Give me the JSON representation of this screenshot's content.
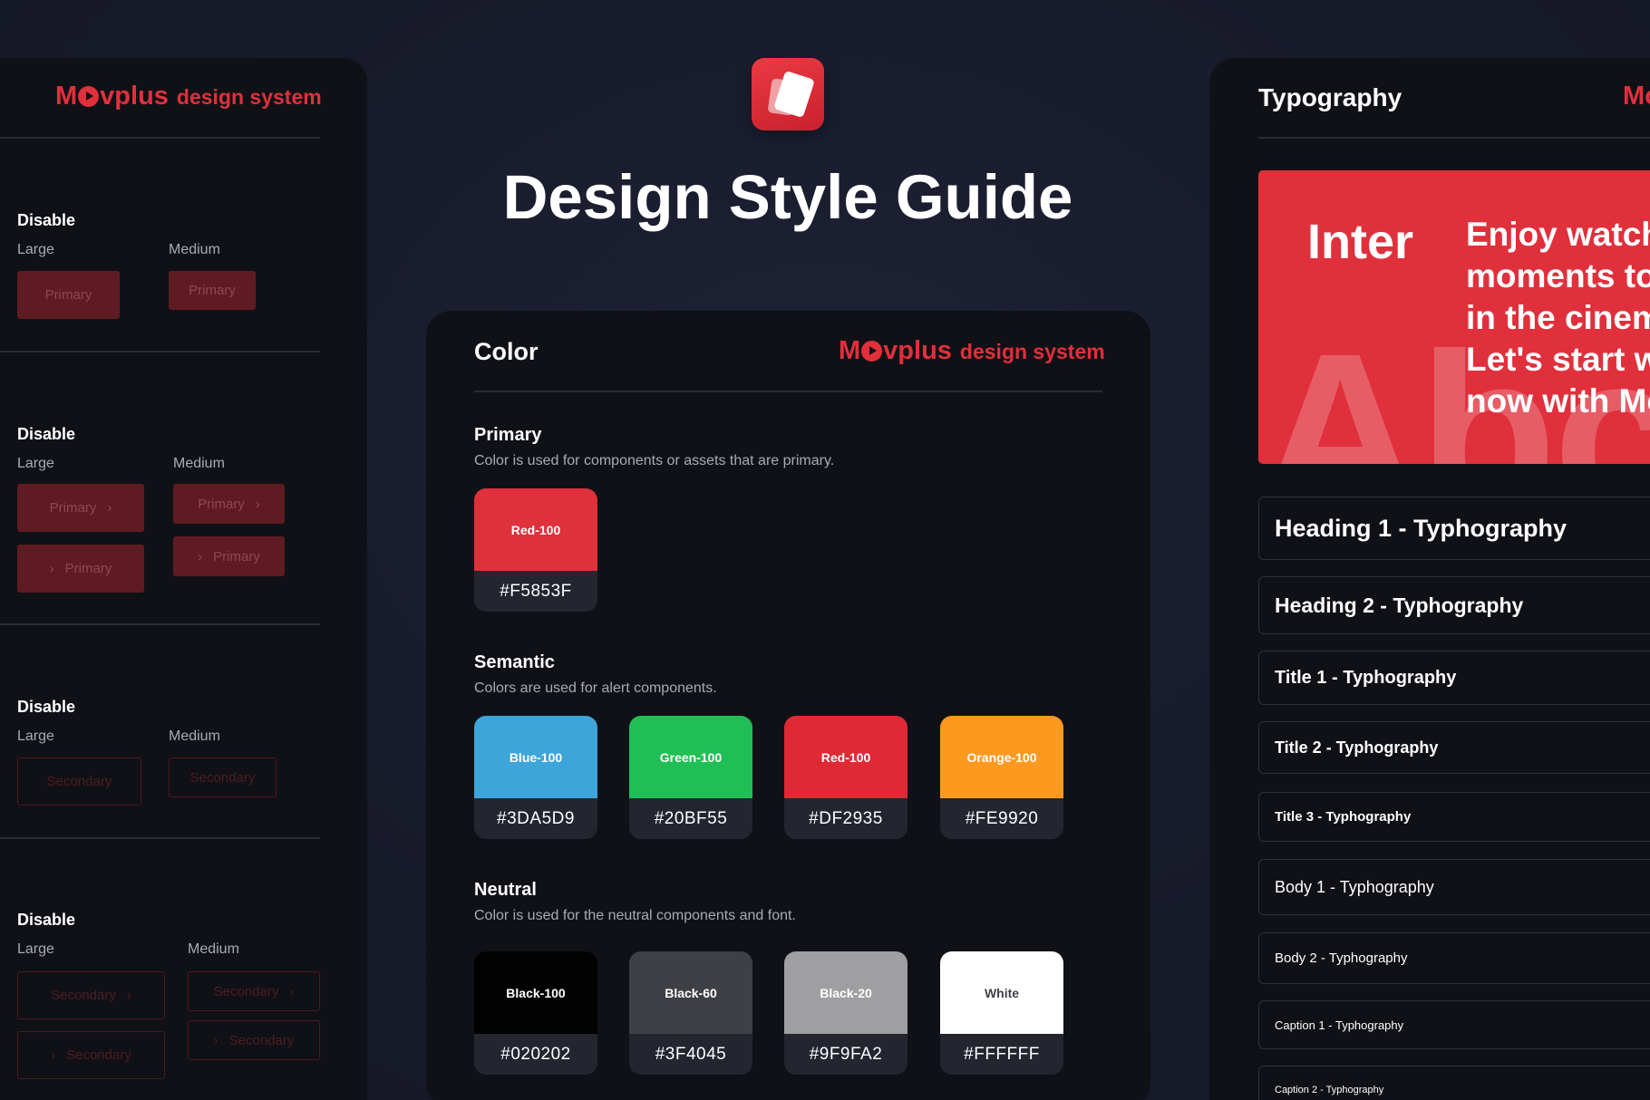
{
  "brand": {
    "name_start": "M",
    "name_end": "vplus",
    "tagline": "design system"
  },
  "header": {
    "title": "Design Style Guide"
  },
  "buttons_panel": {
    "groups": [
      {
        "title": "Disable",
        "large": "Large",
        "medium": "Medium",
        "buttons": {
          "large": "Primary",
          "medium": "Primary"
        }
      },
      {
        "title": "Disable",
        "large": "Large",
        "medium": "Medium",
        "buttons": {
          "large_trailing": "Primary",
          "large_leading": "Primary",
          "medium_trailing": "Primary",
          "medium_leading": "Primary"
        }
      },
      {
        "title": "Disable",
        "large": "Large",
        "medium": "Medium",
        "buttons": {
          "large": "Secondary",
          "medium": "Secondary"
        }
      },
      {
        "title": "Disable",
        "large": "Large",
        "medium": "Medium",
        "buttons": {
          "large_trailing": "Secondary",
          "large_leading": "Secondary",
          "medium_trailing": "Secondary",
          "medium_leading": "Secondary"
        }
      }
    ]
  },
  "color_panel": {
    "title": "Color",
    "primary": {
      "title": "Primary",
      "description": "Color is used for components or assets that are primary.",
      "swatches": [
        {
          "name": "Red-100",
          "hex": "#F5853F",
          "color": "#e0303c"
        }
      ]
    },
    "semantic": {
      "title": "Semantic",
      "description": "Colors are used for alert components.",
      "swatches": [
        {
          "name": "Blue-100",
          "hex": "#3DA5D9",
          "color": "#3da5d9"
        },
        {
          "name": "Green-100",
          "hex": "#20BF55",
          "color": "#20bf55"
        },
        {
          "name": "Red-100",
          "hex": "#DF2935",
          "color": "#df2935"
        },
        {
          "name": "Orange-100",
          "hex": "#FE9920",
          "color": "#fe9920"
        }
      ]
    },
    "neutral": {
      "title": "Neutral",
      "description": "Color is used for the neutral components and font.",
      "swatches": [
        {
          "name": "Black-100",
          "hex": "#020202",
          "color": "#020202"
        },
        {
          "name": "Black-60",
          "hex": "#3F4045",
          "color": "#3f4045"
        },
        {
          "name": "Black-20",
          "hex": "#9F9FA2",
          "color": "#9f9fa2"
        },
        {
          "name": "White",
          "hex": "#FFFFFF",
          "color": "#ffffff"
        }
      ]
    }
  },
  "typography_panel": {
    "title": "Typography",
    "brand_partial": "Mo",
    "hero": {
      "font_name": "Inter",
      "background_text": "Abc",
      "sample": "Enjoy watching\nmoments to\nin the cinema\nLet's start w\nnow with Mo"
    },
    "rows": [
      "Heading 1 - Typhography",
      "Heading 2 - Typhography",
      "Title 1 - Typhography",
      "Title 2 - Typhography",
      "Title 3 - Typhography",
      "Body 1 - Typhography",
      "Body 2 -  Typhography",
      "Caption 1 - Typhography",
      "Caption 2 - Typhography"
    ]
  },
  "colors": {
    "accent": "#e0303c",
    "panel": "#101116",
    "background": "#181b2b"
  }
}
